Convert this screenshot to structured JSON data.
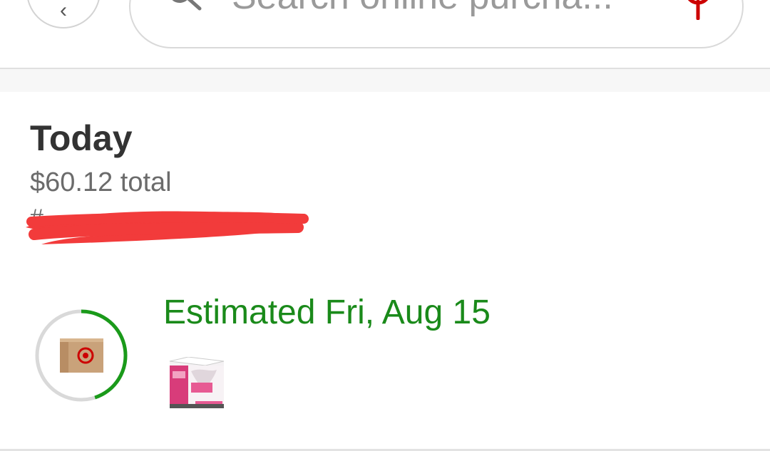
{
  "header": {
    "search_placeholder": "Search online purcha...",
    "icons": {
      "back": "chevron-left-icon",
      "search": "search-icon",
      "location": "location-pin-icon"
    }
  },
  "order": {
    "date_heading": "Today",
    "total": "$60.12 total",
    "order_number": "#",
    "delivery_estimate": "Estimated Fri, Aug 15",
    "delivery_progress": 0.45,
    "icons": {
      "package": "package-icon",
      "product": "product-thumbnail"
    }
  },
  "colors": {
    "progress_green": "#1a9a1a",
    "estimate_green": "#1a8a1a",
    "brand_red": "#cc0000",
    "redaction_red": "#f23b3b"
  }
}
